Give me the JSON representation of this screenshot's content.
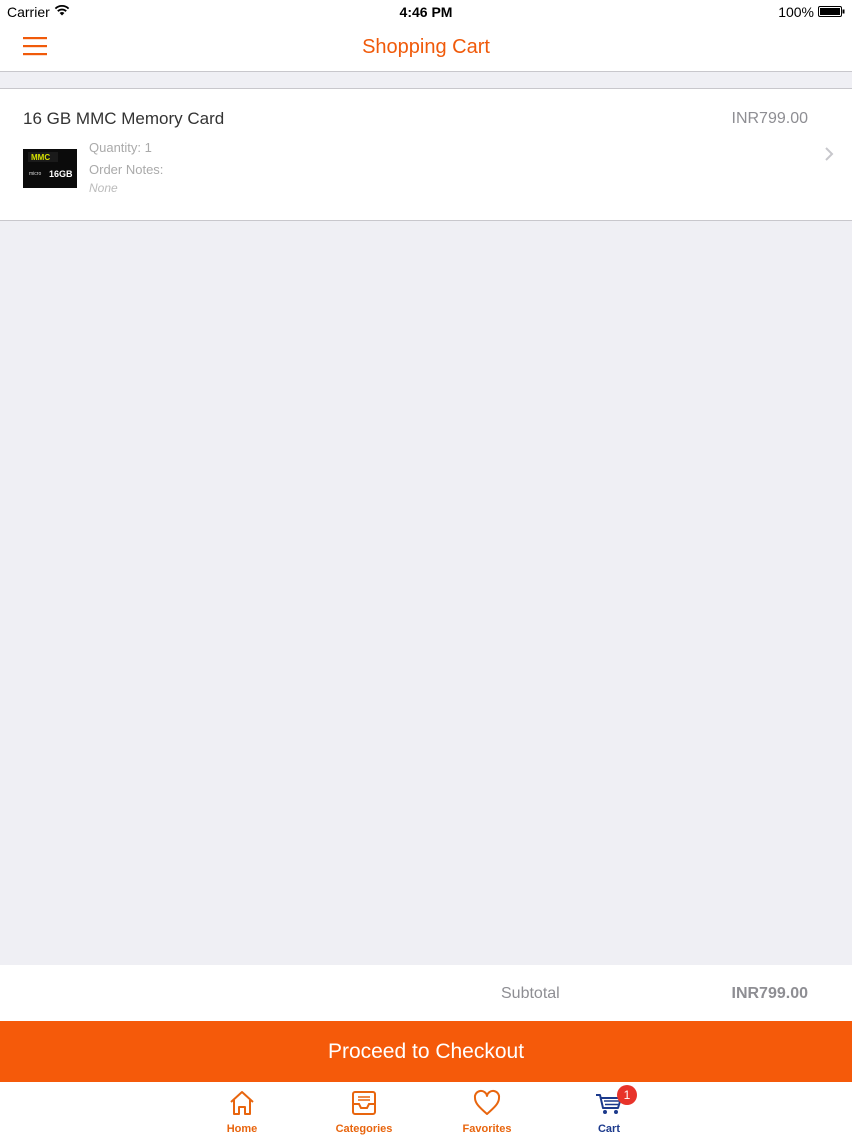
{
  "status_bar": {
    "carrier": "Carrier",
    "time": "4:46 PM",
    "battery": "100%"
  },
  "nav": {
    "title": "Shopping Cart",
    "accent_color": "#f05a0a"
  },
  "cart": {
    "items": [
      {
        "name": "16 GB MMC Memory Card",
        "price": "INR799.00",
        "quantity": "Quantity: 1",
        "notes_label": "Order Notes:",
        "notes_value": "None",
        "thumbnail_brand": "MMC",
        "thumbnail_capacity": "16GB"
      }
    ]
  },
  "summary": {
    "subtotal_label": "Subtotal",
    "subtotal_value": "INR799.00"
  },
  "checkout": {
    "label": "Proceed to Checkout",
    "color": "#f55a0a"
  },
  "tabs": [
    {
      "label": "Home",
      "icon": "home-icon"
    },
    {
      "label": "Categories",
      "icon": "inbox-icon"
    },
    {
      "label": "Favorites",
      "icon": "heart-icon"
    },
    {
      "label": "Cart",
      "icon": "cart-icon",
      "badge": "1",
      "active": true
    }
  ]
}
